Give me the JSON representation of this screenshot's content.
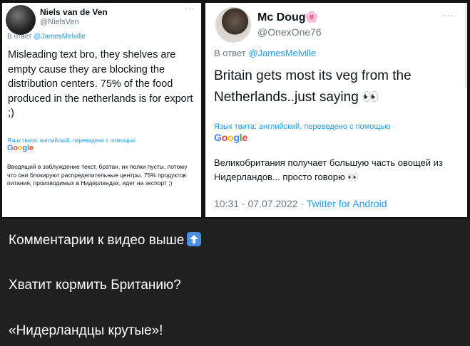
{
  "tweets": [
    {
      "author_name": "Niels van de Ven",
      "author_handle": "@NielsVen",
      "more": "···",
      "reply_prefix": "В ответ ",
      "reply_handle": "@JamesMelville",
      "text": "Misleading text bro, they shelves are empty cause they are blocking the distribution centers. 75% of the food produced in the netherlands is for export ;)",
      "translation_note": "Язык твита: английский, переведено с помощью",
      "translator": "Google",
      "translated_text": "Вводящий в заблуждение текст, братан, их полки пусты, потому что они блокируют распределительные центры. 75% продуктов питания, производимых в Нидерландах, идет на экспорт ;)"
    },
    {
      "author_name": "Mc Doug",
      "author_flair": "🌸",
      "author_handle": "@OnexOne76",
      "more": "···",
      "reply_prefix": "В ответ ",
      "reply_handle": "@JamesMelville",
      "text": "Britain gets most its veg from the Netherlands..just saying 👀",
      "translation_note": "Язык твита: английский, переведено с помощью",
      "translator": "Google",
      "translated_text": "Великобритания получает большую часть овощей из Нидерландов... просто говорю 👀",
      "time": "10:31 · 07.07.2022 · ",
      "source": "Twitter for Android"
    }
  ],
  "captions": [
    "Комментарии к видео выше",
    "Хватит кормить Британию?",
    "«Нидерландцы крутые»!"
  ],
  "colors": {
    "background": "#202020",
    "link": "#1d9bf0",
    "icon_up": "#4a8fdf"
  },
  "icons": [
    "up-arrow-icon"
  ]
}
